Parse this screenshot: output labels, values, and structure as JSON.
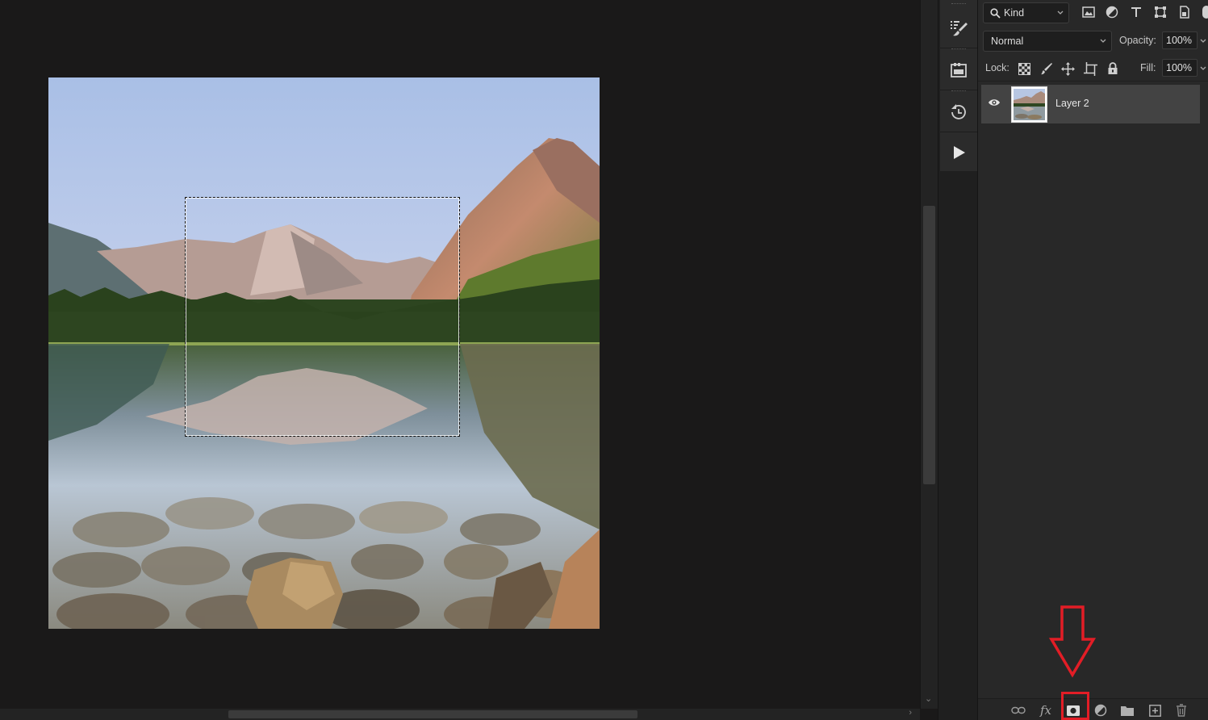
{
  "layers_panel": {
    "filter": {
      "kind_label": "Kind"
    },
    "blend_mode": "Normal",
    "opacity_label": "Opacity:",
    "opacity_value": "100%",
    "lock_label": "Lock:",
    "fill_label": "Fill:",
    "fill_value": "100%",
    "layers": [
      {
        "name": "Layer 2",
        "visible": true,
        "selected": true
      }
    ],
    "bottom_bar_icons": [
      "link-layers-icon",
      "fx-icon",
      "add-layer-mask-icon",
      "adjustment-layer-icon",
      "group-folder-icon",
      "new-layer-icon",
      "trash-icon"
    ],
    "fx_label": "fx"
  },
  "panel_strip_icons": [
    "brush-settings-icon",
    "library-icon",
    "history-icon",
    "actions-play-icon"
  ],
  "annotation": {
    "highlight_color": "#e21d26",
    "target": "add-layer-mask-icon"
  },
  "colors": {
    "canvas_bg": "#1a1919",
    "panel_bg": "#282828",
    "selected_layer": "#434343"
  }
}
